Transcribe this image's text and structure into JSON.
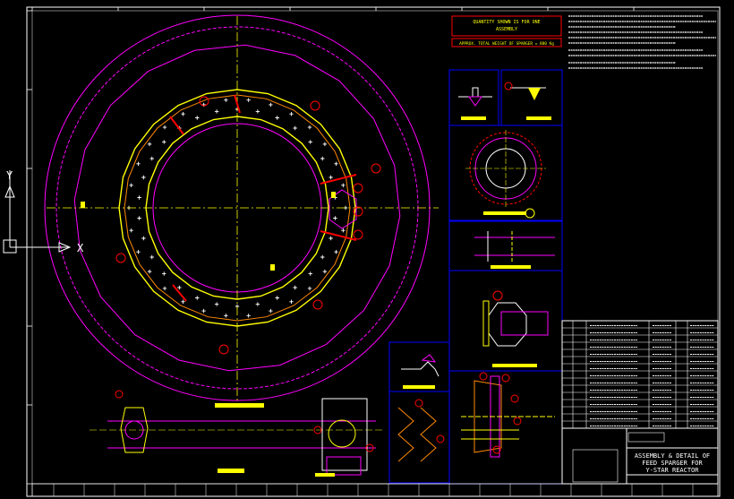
{
  "drawing": {
    "title_line1": "ASSEMBLY & DETAIL OF",
    "title_line2": "FEED SPARGER FOR",
    "title_line3": "Y-STAR REACTOR",
    "banner_line1": "QUANTITY SHOWN IS FOR ONE",
    "banner_line2": "ASSEMBLY",
    "weight_note": "APPROX. TOTAL WEIGHT OF SPARGER = 880 Kg",
    "ucs_y_label": "Y",
    "ucs_x_label": "X"
  },
  "colors": {
    "background": "#000000",
    "frame": "#ffffff",
    "outer_circles": "#ff00ff",
    "ring": "#ffff00",
    "ring_inner": "#ff8800",
    "centerline": "#ffff00",
    "detail_box": "#0000ff",
    "callout": "#ff0000",
    "label_bar": "#ffff00"
  }
}
